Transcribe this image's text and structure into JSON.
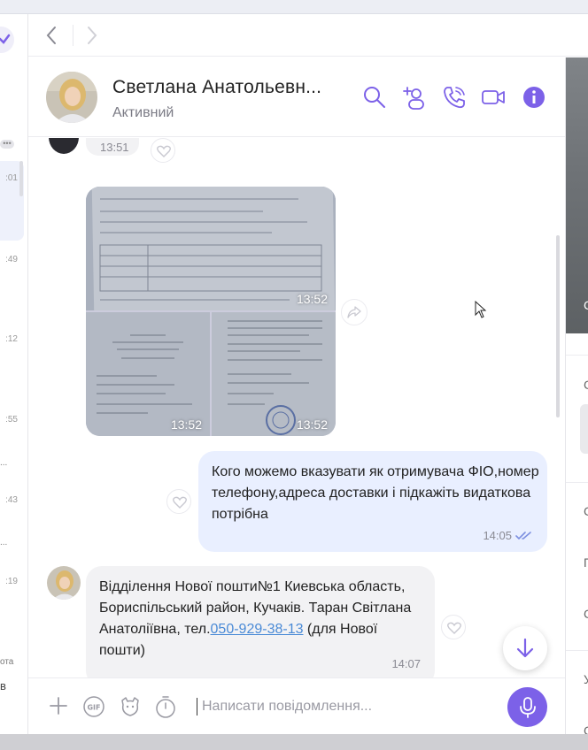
{
  "contact": {
    "name": "Светлана Анатольевн...",
    "status": "Активний"
  },
  "chat_list_times": [
    ":01",
    ":49",
    ":12",
    ":55",
    ":43",
    ":19"
  ],
  "chat_list_snippets": [
    "...",
    "...",
    "ота",
    "в"
  ],
  "messages": {
    "top_time": "13:51",
    "photos": [
      {
        "time": "13:52"
      },
      {
        "time": "13:52"
      },
      {
        "time": "13:52"
      }
    ],
    "outgoing": {
      "text": "Кого можемо вказувати як отримувача ФІО,номер телефону,адреса доставки і підкажіть видаткова потрібна",
      "time": "14:05"
    },
    "incoming": {
      "text_before_link": "Відділення Нової пошти№1 Киевська область, Бориспільський район, Кучаків. Таран Світлана Анатоліївна, тел.",
      "phone": "050-929-38-13",
      "text_after_link": " (для Нової пошти)",
      "time": "14:07"
    }
  },
  "composer": {
    "placeholder": "Написати повідомлення..."
  },
  "right_panel": {
    "photo_letter": "С",
    "items": [
      "С",
      "С",
      "П",
      "С",
      "У",
      "С"
    ]
  },
  "colors": {
    "accent": "#7c61e8",
    "outgoing_bubble": "#e9efff",
    "incoming_bubble": "#f2f2f4",
    "link": "#4a8ad6"
  }
}
